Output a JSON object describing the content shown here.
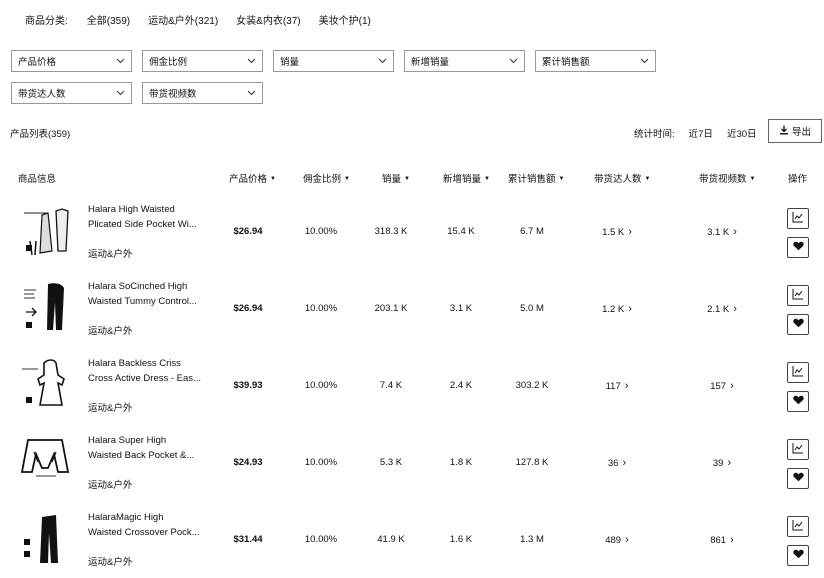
{
  "category_bar": {
    "label": "商品分类:",
    "items": [
      "全部(359)",
      "运动&户外(321)",
      "女装&内衣(37)",
      "美妆个护(1)"
    ]
  },
  "filters": [
    "产品价格",
    "佣金比例",
    "销量",
    "新增销量",
    "累计销售额",
    "带货达人数",
    "带货视频数"
  ],
  "list_title": "产品列表(359)",
  "stat": {
    "label": "统计时间:",
    "options": [
      "近7日",
      "近30日"
    ]
  },
  "export_label": "导出",
  "table": {
    "headers": {
      "product": "商品信息",
      "price": "产品价格",
      "commission": "佣金比例",
      "sales": "销量",
      "new_sales": "新增销量",
      "revenue": "累计销售额",
      "influencers": "带货达人数",
      "videos": "带货视频数",
      "actions": "操作"
    },
    "rows": [
      {
        "name1": "Halara High Waisted",
        "name2": "Plicated Side Pocket Wi...",
        "category": "运动&户外",
        "price": "$26.94",
        "commission": "10.00%",
        "sales": "318.3 K",
        "new_sales": "15.4 K",
        "revenue": "6.7 M",
        "influencers": "1.5 K",
        "videos": "3.1 K"
      },
      {
        "name1": "Halara SoCinched High",
        "name2": "Waisted Tummy Control...",
        "category": "运动&户外",
        "price": "$26.94",
        "commission": "10.00%",
        "sales": "203.1 K",
        "new_sales": "3.1 K",
        "revenue": "5.0 M",
        "influencers": "1.2 K",
        "videos": "2.1 K"
      },
      {
        "name1": "Halara Backless Criss",
        "name2": "Cross Active Dress - Eas...",
        "category": "运动&户外",
        "price": "$39.93",
        "commission": "10.00%",
        "sales": "7.4 K",
        "new_sales": "2.4 K",
        "revenue": "303.2 K",
        "influencers": "117",
        "videos": "157"
      },
      {
        "name1": "Halara Super High",
        "name2": "Waisted Back Pocket &...",
        "category": "运动&户外",
        "price": "$24.93",
        "commission": "10.00%",
        "sales": "5.3 K",
        "new_sales": "1.8 K",
        "revenue": "127.8 K",
        "influencers": "36",
        "videos": "39"
      },
      {
        "name1": "HalaraMagic High",
        "name2": "Waisted Crossover Pock...",
        "category": "运动&户外",
        "price": "$31.44",
        "commission": "10.00%",
        "sales": "41.9 K",
        "new_sales": "1.6 K",
        "revenue": "1.3 M",
        "influencers": "489",
        "videos": "861"
      }
    ]
  },
  "icons": {
    "chevron": "chevron-down-icon",
    "export": "download-icon",
    "trend": "trend-chart-icon",
    "favorite": "heart-icon",
    "link_arrow": "chevron-right-icon"
  }
}
